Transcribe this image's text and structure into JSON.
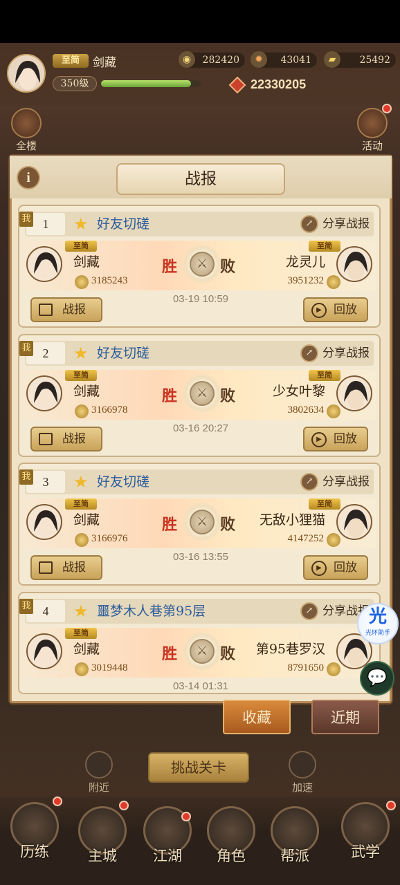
{
  "hud": {
    "vip_tag": "至简",
    "player_name": "剑藏",
    "level": "350级",
    "xp_progress": 0.9,
    "resources": [
      {
        "name": "coin-icon",
        "value": "282420"
      },
      {
        "name": "ingot-icon",
        "value": "43041"
      },
      {
        "name": "gold-icon",
        "value": "25492"
      }
    ],
    "power": "22330205",
    "left_button": "全楼",
    "right_button": "活动"
  },
  "panel": {
    "title": "战报",
    "info": "i"
  },
  "battles": [
    {
      "index": "1",
      "title": "好友切磋",
      "share": "分享战报",
      "me_tag": "我",
      "my_vip": "至简",
      "my_name": "剑藏",
      "my_power": "3185243",
      "win": "胜",
      "lose": "败",
      "time": "03-19 10:59",
      "opp_vip": "至简",
      "opp_name": "龙灵儿",
      "opp_power": "3951232",
      "report_btn": "战报",
      "replay_btn": "回放"
    },
    {
      "index": "2",
      "title": "好友切磋",
      "share": "分享战报",
      "me_tag": "我",
      "my_vip": "至简",
      "my_name": "剑藏",
      "my_power": "3166978",
      "win": "胜",
      "lose": "败",
      "time": "03-16 20:27",
      "opp_vip": "至简",
      "opp_name": "少女叶黎",
      "opp_power": "3802634",
      "report_btn": "战报",
      "replay_btn": "回放"
    },
    {
      "index": "3",
      "title": "好友切磋",
      "share": "分享战报",
      "me_tag": "我",
      "my_vip": "至简",
      "my_name": "剑藏",
      "my_power": "3166976",
      "win": "胜",
      "lose": "败",
      "time": "03-16 13:55",
      "opp_vip": "至简",
      "opp_name": "无敌小狸猫",
      "opp_power": "4147252",
      "report_btn": "战报",
      "replay_btn": "回放"
    },
    {
      "index": "4",
      "title": "噩梦木人巷第95层",
      "share": "分享战报",
      "me_tag": "我",
      "my_vip": "至简",
      "my_name": "剑藏",
      "my_power": "3019448",
      "win": "胜",
      "lose": "败",
      "time": "03-14 01:31",
      "opp_vip": "",
      "opp_name": "第95巷罗汉",
      "opp_power": "8791650",
      "report_btn": "",
      "replay_btn": ""
    }
  ],
  "tabs": {
    "favorite": "收藏",
    "recent": "近期"
  },
  "challenge": "挑战关卡",
  "nearby": "附近",
  "speedup": "加速",
  "nav": [
    "历练",
    "主城",
    "江湖",
    "角色",
    "帮派",
    "武学"
  ],
  "floater": {
    "glyph": "光",
    "label": "光环助手"
  },
  "chat_icon": "💬",
  "colors": {
    "accent": "#b68c57",
    "win": "#c8321f",
    "title_blue": "#2c5c9d"
  }
}
